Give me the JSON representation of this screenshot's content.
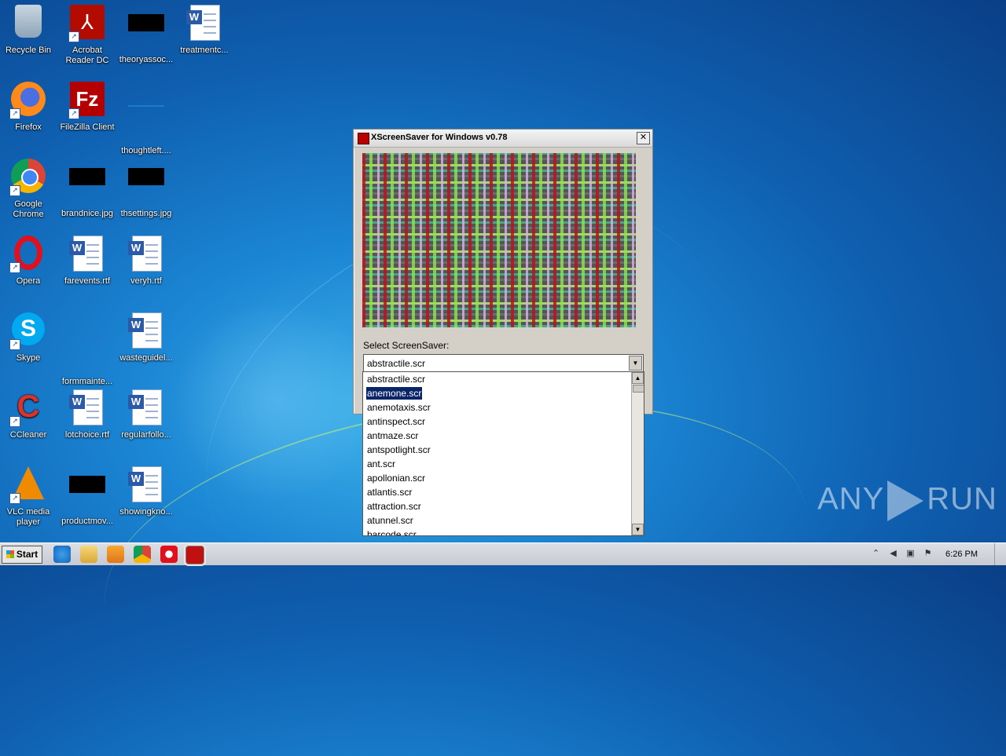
{
  "desktop_icons": [
    {
      "label": "Recycle Bin"
    },
    {
      "label": "Acrobat Reader DC"
    },
    {
      "label": "theoryassoc..."
    },
    {
      "label": "treatmentc..."
    },
    {
      "label": "Firefox"
    },
    {
      "label": "FileZilla Client"
    },
    {
      "label": "thoughtleft...."
    },
    {
      "label": "Google Chrome"
    },
    {
      "label": "brandnice.jpg"
    },
    {
      "label": "thsettings.jpg"
    },
    {
      "label": "Opera"
    },
    {
      "label": "farevents.rtf"
    },
    {
      "label": "veryh.rtf"
    },
    {
      "label": "Skype"
    },
    {
      "label": "formmainte..."
    },
    {
      "label": "wasteguidel..."
    },
    {
      "label": "CCleaner"
    },
    {
      "label": "lotchoice.rtf"
    },
    {
      "label": "regularfollo..."
    },
    {
      "label": "VLC media player"
    },
    {
      "label": "productmov..."
    },
    {
      "label": "showingkno..."
    }
  ],
  "dialog": {
    "title": "XScreenSaver for Windows v0.78",
    "close_glyph": "✕",
    "select_label": "Select ScreenSaver:",
    "selected_value": "abstractile.scr",
    "combo_arrow": "▼"
  },
  "dropdown": {
    "items": [
      "abstractile.scr",
      "anemone.scr",
      "anemotaxis.scr",
      "antinspect.scr",
      "antmaze.scr",
      "antspotlight.scr",
      "ant.scr",
      "apollonian.scr",
      "atlantis.scr",
      "attraction.scr",
      "atunnel.scr",
      "barcode.scr"
    ],
    "highlighted": "anemone.scr",
    "scroll_up": "▲",
    "scroll_down": "▼"
  },
  "taskbar": {
    "start_label": "Start",
    "clock": "6:26 PM"
  },
  "watermark": {
    "left": "ANY",
    "right": "RUN"
  }
}
